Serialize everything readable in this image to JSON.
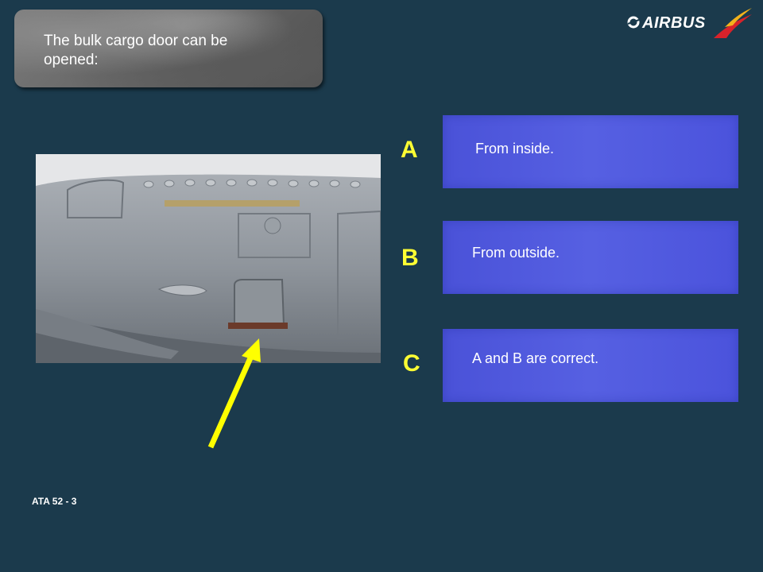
{
  "question": {
    "text": "The bulk cargo door can be opened:"
  },
  "brand": {
    "name": "AIRBUS",
    "colors": {
      "wing_red": "#d8222a",
      "wing_yellow": "#f2b21c"
    }
  },
  "photo": {
    "icon": "aircraft-fuselage-photo"
  },
  "options": [
    {
      "letter": "A",
      "text": "From inside."
    },
    {
      "letter": "B",
      "text": "From outside."
    },
    {
      "letter": "C",
      "text": "A and B are correct."
    }
  ],
  "footer": {
    "text": "ATA 52 - 3"
  },
  "colors": {
    "background": "#1b3a4c",
    "option_box": "#4f58df",
    "option_letter": "#ffff33",
    "arrow": "#ffff00"
  }
}
